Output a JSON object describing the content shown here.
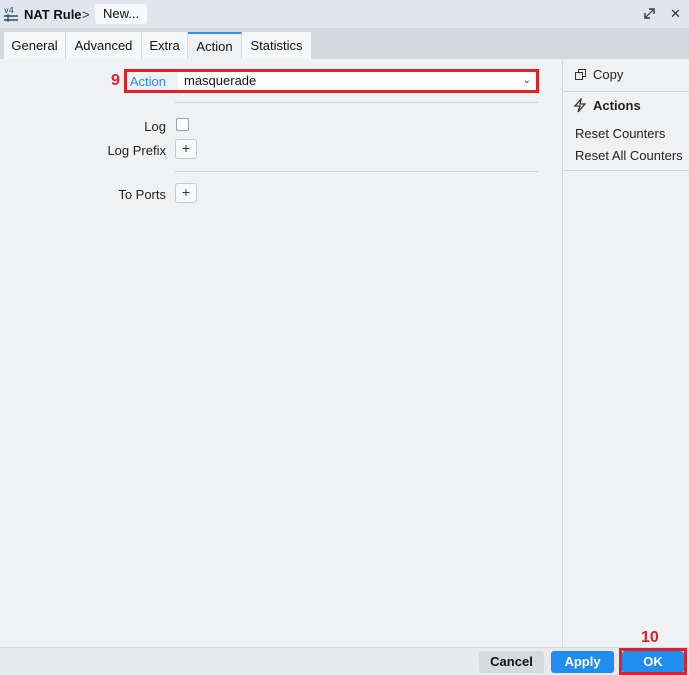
{
  "window": {
    "app_badge": "v4",
    "breadcrumb_title": "NAT Rule",
    "breadcrumb_separator": ">",
    "breadcrumb_current": "New..."
  },
  "tabs": [
    {
      "label": "General",
      "active": false
    },
    {
      "label": "Advanced",
      "active": false
    },
    {
      "label": "Extra",
      "active": false
    },
    {
      "label": "Action",
      "active": true
    },
    {
      "label": "Statistics",
      "active": false
    }
  ],
  "form": {
    "action": {
      "label": "Action",
      "value": "masquerade"
    },
    "log": {
      "label": "Log",
      "checked": false
    },
    "log_prefix": {
      "label": "Log Prefix",
      "add_symbol": "+"
    },
    "to_ports": {
      "label": "To Ports",
      "add_symbol": "+"
    }
  },
  "sidebar": {
    "copy_label": "Copy",
    "actions_heading": "Actions",
    "reset_counters": "Reset Counters",
    "reset_all_counters": "Reset All Counters"
  },
  "footer": {
    "cancel_label": "Cancel",
    "apply_label": "Apply",
    "ok_label": "OK"
  },
  "annotations": {
    "step_action": "9",
    "step_ok": "10"
  },
  "colors": {
    "accent": "#1f8ef0",
    "highlight": "#e0202a",
    "label_active": "#1f8ef0"
  }
}
